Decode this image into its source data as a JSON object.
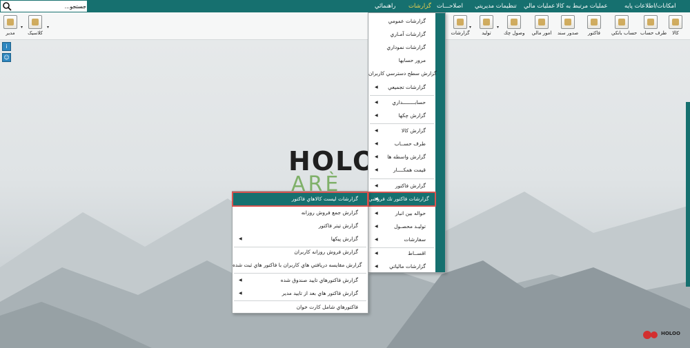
{
  "menubar": {
    "items": [
      {
        "label": "امکانات/اطلاعات پايه",
        "active": false
      },
      {
        "label": "عمليات مرتبط به کالا",
        "active": false
      },
      {
        "label": "عمليات مالي",
        "active": false
      },
      {
        "label": "تنظيمات مديريتي",
        "active": false
      },
      {
        "label": "اصلاحـــات",
        "active": false
      },
      {
        "label": "گزارشات",
        "active": true
      },
      {
        "label": "راهنمائي",
        "active": false
      }
    ],
    "search_value": "جستجو..."
  },
  "toolbar": {
    "buttons": [
      {
        "label": "کالا"
      },
      {
        "label": "طرف حساب"
      },
      {
        "label": "حساب بانکي"
      },
      {
        "label": "فاکتور"
      },
      {
        "label": "صدور سند"
      },
      {
        "label": "امور مالي"
      },
      {
        "label": "وصول چك"
      },
      {
        "label": "توليد"
      },
      {
        "label": "گزارشات"
      },
      {
        "label": "کلاسيک"
      },
      {
        "label": "مدير"
      }
    ]
  },
  "reports_menu": {
    "items": [
      {
        "label": "گزارشات عمومي",
        "arrow": false
      },
      {
        "label": "گزارشات آمـاري",
        "arrow": false
      },
      {
        "label": "گزارشات نموداري",
        "arrow": false
      },
      {
        "label": "مرور حسابها",
        "arrow": false
      },
      {
        "label": "گزارش سطح دسترسي کاربران",
        "arrow": false
      },
      {
        "label": "گزارشات تجميعي",
        "arrow": true
      },
      {
        "label": "حسابــــــــداري",
        "arrow": true
      },
      {
        "label": "گزارش چکها",
        "arrow": true
      },
      {
        "label": "گزارش کالا",
        "arrow": true
      },
      {
        "label": "طرف حســاب",
        "arrow": true
      },
      {
        "label": "گزارش واسطه ها",
        "arrow": true
      },
      {
        "label": "قيمت همکــــار",
        "arrow": true
      },
      {
        "label": "گزارش فاکتور",
        "arrow": true
      },
      {
        "label": "گزارشات فاکتور تك فروشي",
        "arrow": true
      },
      {
        "label": "حواله بين انبار",
        "arrow": true
      },
      {
        "label": "توليـد محصـول",
        "arrow": true
      },
      {
        "label": "سفارشات",
        "arrow": true
      },
      {
        "label": "اقســاط",
        "arrow": true
      },
      {
        "label": "گزارشات مالياتي",
        "arrow": true
      }
    ]
  },
  "submenu": {
    "items": [
      {
        "label": "گزارشات ليست کالاهاي فاکتور",
        "arrow": false
      },
      {
        "label": "گزارش جمع فروش روزانه",
        "arrow": false
      },
      {
        "label": "گزارش تيتر فاکتور",
        "arrow": false
      },
      {
        "label": "گزارش پيکها",
        "arrow": true
      },
      {
        "label": "گزارش فروش روزانه کاربران",
        "arrow": false
      },
      {
        "label": "گزارش مقايسه دريافتي هاي  کاربران با فاکتور هاي ثبت شده",
        "arrow": false
      },
      {
        "label": "گزارش فاکتورهاي تاييد صندوق شده",
        "arrow": true
      },
      {
        "label": "گزارش فاکتور هاي بعد از تاييد مدير",
        "arrow": true
      },
      {
        "label": "فاکتورهاي شامل کارت خوان",
        "arrow": false
      }
    ]
  },
  "logo": {
    "main": "HOLO",
    "sub": "ARÈ",
    "corner": "HOLOO"
  }
}
